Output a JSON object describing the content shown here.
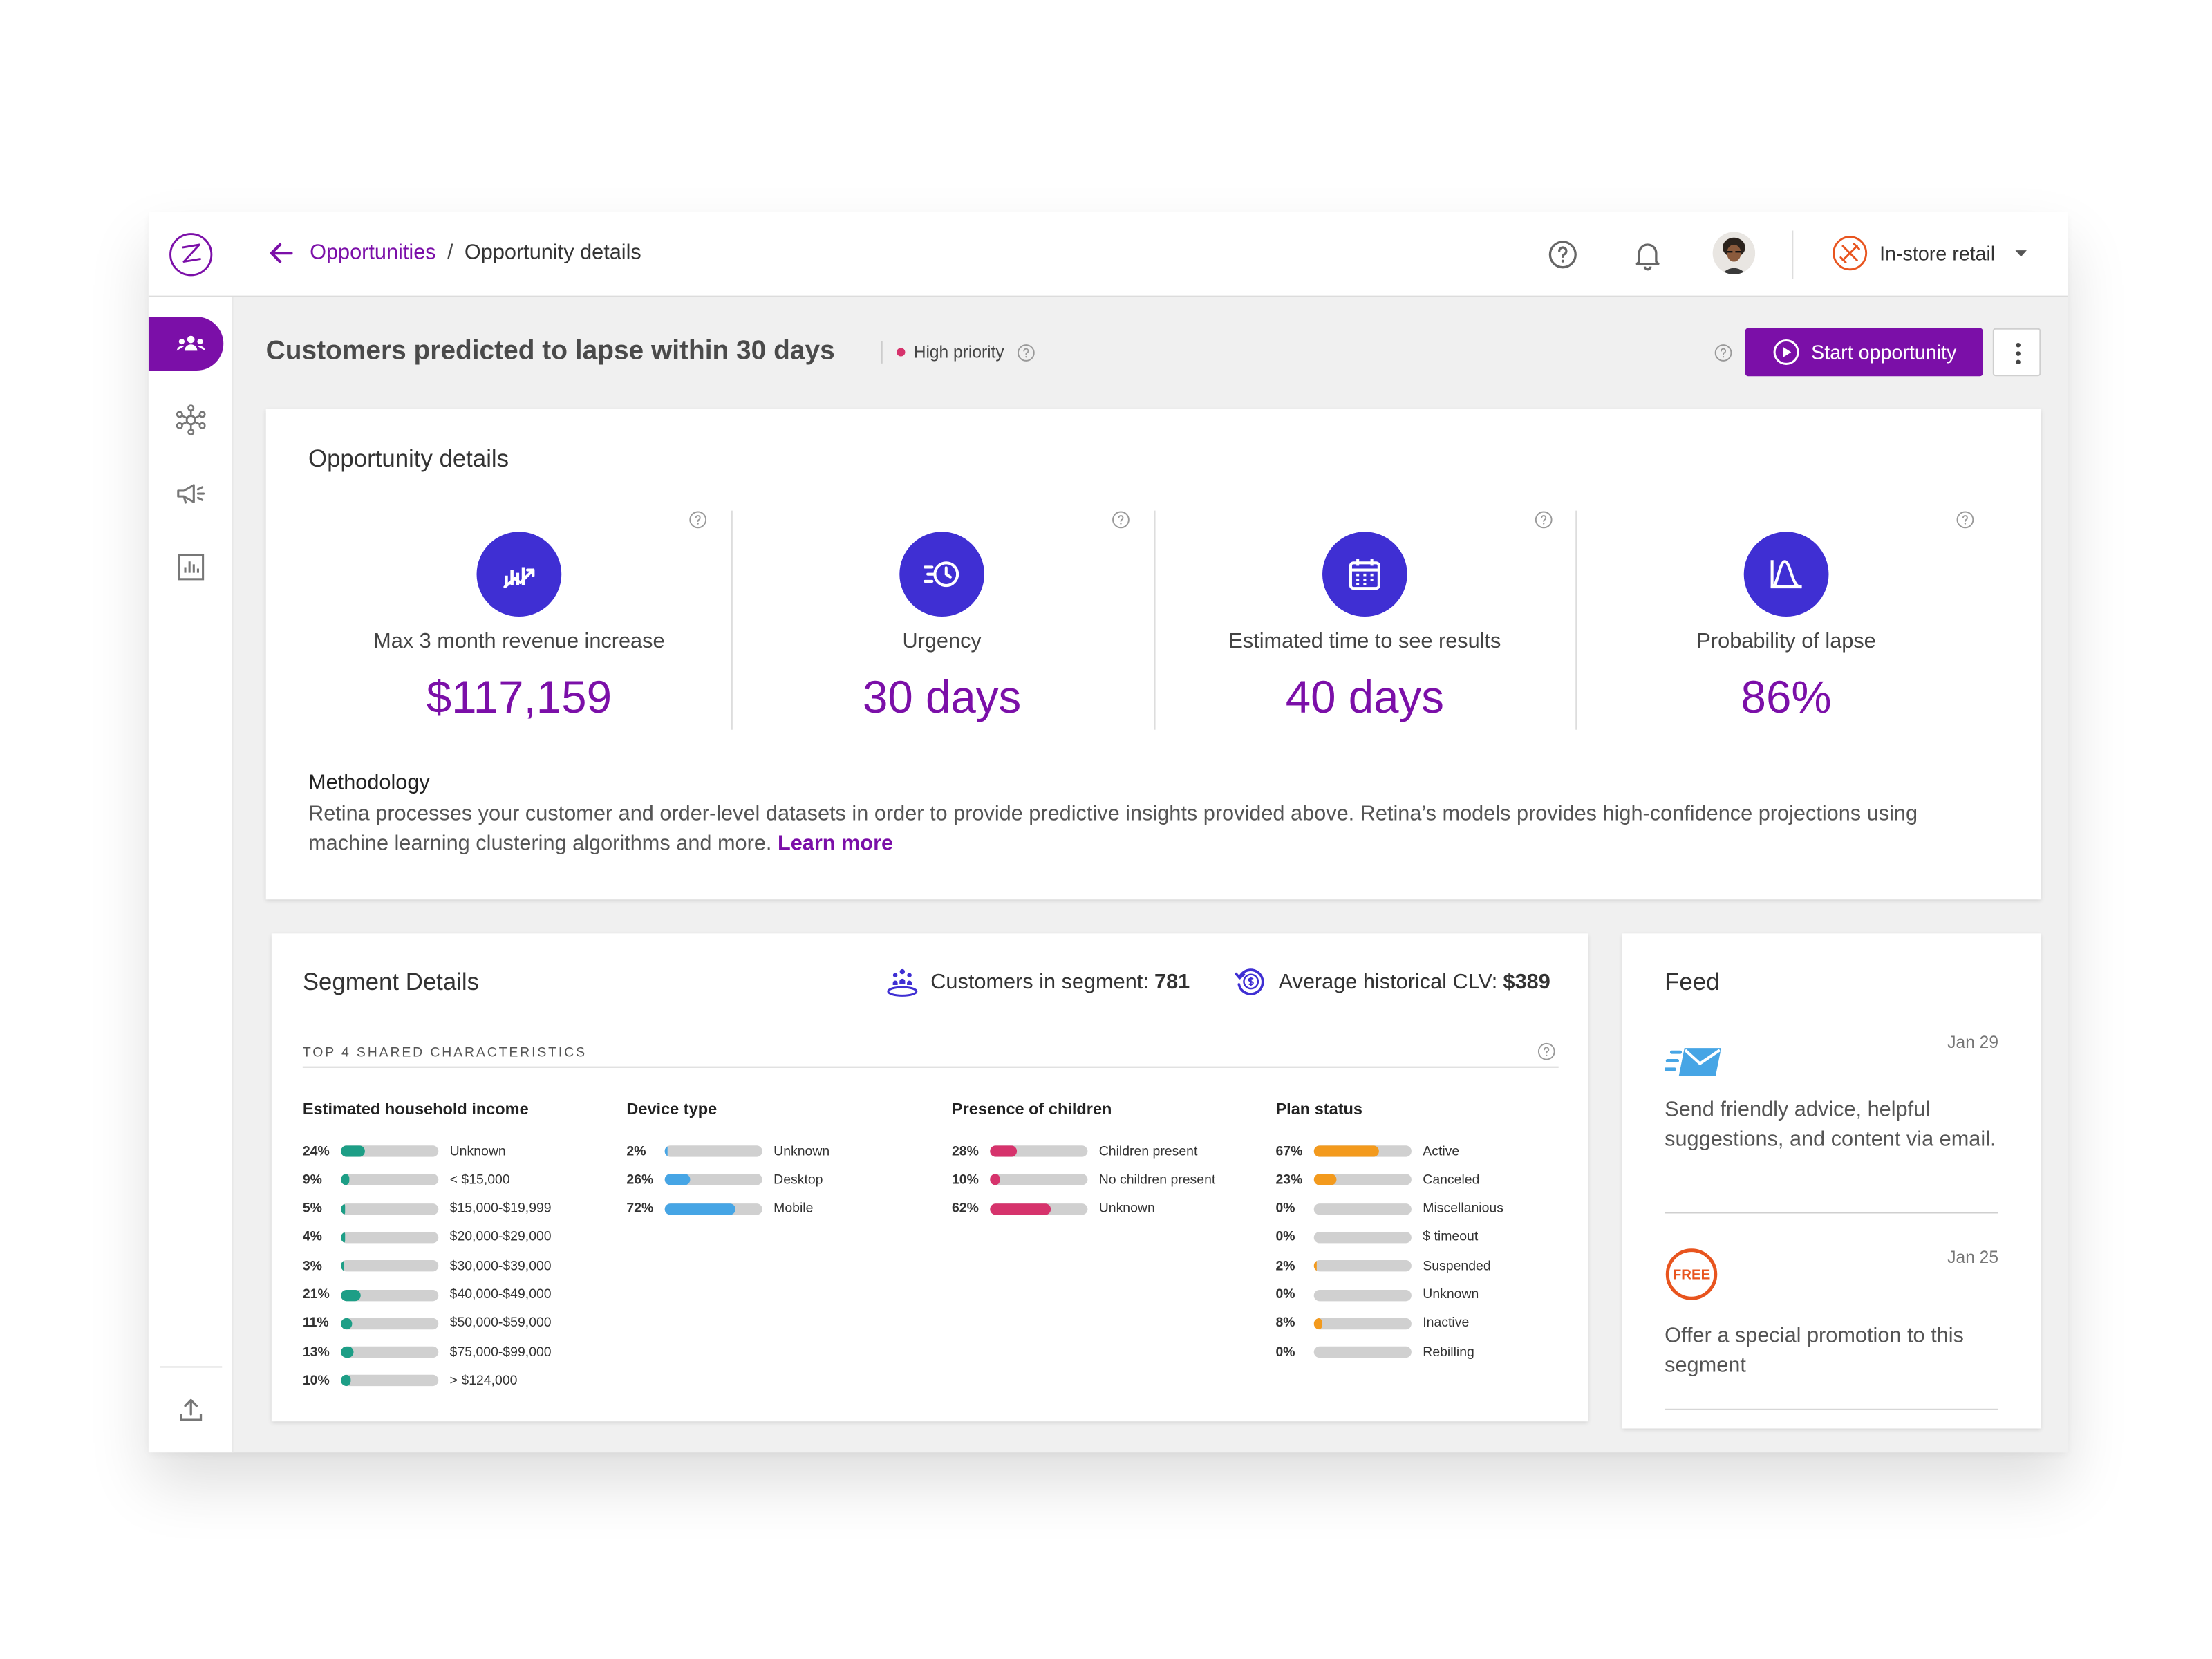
{
  "breadcrumb": {
    "parent": "Opportunities",
    "separator": "/",
    "current": "Opportunity details"
  },
  "header": {
    "store": "In-store retail"
  },
  "page": {
    "title": "Customers predicted to lapse within 30 days",
    "priority": "High priority",
    "start_button": "Start opportunity"
  },
  "details": {
    "title": "Opportunity details",
    "metrics": [
      {
        "label": "Max 3 month revenue increase",
        "value": "$117,159",
        "icon": "revenue-chart-icon"
      },
      {
        "label": "Urgency",
        "value": "30 days",
        "icon": "fast-clock-icon"
      },
      {
        "label": "Estimated time to see results",
        "value": "40 days",
        "icon": "calendar-icon"
      },
      {
        "label": "Probability of lapse",
        "value": "86%",
        "icon": "distribution-curve-icon"
      }
    ],
    "methodology_title": "Methodology",
    "methodology_text": "Retina processes your customer and order-level datasets in order to provide predictive insights provided above. Retina’s models provides high-confidence projections using machine learning clustering algorithms and more.",
    "learn_more": "Learn more"
  },
  "segment": {
    "title": "Segment Details",
    "customers_label": "Customers in segment:",
    "customers_value": "781",
    "clv_label": "Average historical CLV:",
    "clv_value": "$389",
    "characteristics_title": "TOP 4 SHARED CHARACTERISTICS",
    "columns": [
      {
        "title": "Estimated household income",
        "color": "#1d9e86",
        "rows": [
          {
            "pct": "24%",
            "value": 24,
            "label": "Unknown"
          },
          {
            "pct": "9%",
            "value": 9,
            "label": "< $15,000"
          },
          {
            "pct": "5%",
            "value": 5,
            "label": "$15,000-$19,999"
          },
          {
            "pct": "4%",
            "value": 4,
            "label": "$20,000-$29,000"
          },
          {
            "pct": "3%",
            "value": 3,
            "label": "$30,000-$39,000"
          },
          {
            "pct": "21%",
            "value": 21,
            "label": "$40,000-$49,000"
          },
          {
            "pct": "11%",
            "value": 11,
            "label": "$50,000-$59,000"
          },
          {
            "pct": "13%",
            "value": 13,
            "label": "$75,000-$99,000"
          },
          {
            "pct": "10%",
            "value": 10,
            "label": "> $124,000"
          }
        ]
      },
      {
        "title": "Device type",
        "color": "#46a5e5",
        "rows": [
          {
            "pct": "2%",
            "value": 2,
            "label": "Unknown"
          },
          {
            "pct": "26%",
            "value": 26,
            "label": "Desktop"
          },
          {
            "pct": "72%",
            "value": 72,
            "label": "Mobile"
          }
        ]
      },
      {
        "title": "Presence of children",
        "color": "#d6336c",
        "rows": [
          {
            "pct": "28%",
            "value": 28,
            "label": "Children present"
          },
          {
            "pct": "10%",
            "value": 10,
            "label": "No children present"
          },
          {
            "pct": "62%",
            "value": 62,
            "label": "Unknown"
          }
        ]
      },
      {
        "title": "Plan status",
        "color": "#f39a1d",
        "rows": [
          {
            "pct": "67%",
            "value": 67,
            "label": "Active"
          },
          {
            "pct": "23%",
            "value": 23,
            "label": "Canceled"
          },
          {
            "pct": "0%",
            "value": 0,
            "label": "Miscellanious"
          },
          {
            "pct": "0%",
            "value": 0,
            "label": "$ timeout"
          },
          {
            "pct": "2%",
            "value": 2,
            "label": "Suspended"
          },
          {
            "pct": "0%",
            "value": 0,
            "label": "Unknown"
          },
          {
            "pct": "8%",
            "value": 8,
            "label": "Inactive"
          },
          {
            "pct": "0%",
            "value": 0,
            "label": "Rebilling"
          }
        ]
      }
    ]
  },
  "feed": {
    "title": "Feed",
    "items": [
      {
        "date": "Jan 29",
        "text": "Send friendly advice, helpful suggestions, and content via email.",
        "icon": "email-send-icon"
      },
      {
        "date": "Jan 25",
        "text": "Offer a special promotion to this segment",
        "icon": "free-badge-icon",
        "badge": "FREE"
      }
    ]
  },
  "colors": {
    "accent": "#7b0fa8",
    "icon_circle": "#3f2fd3",
    "priority": "#d6336c",
    "email_icon": "#46a5e5",
    "free_badge": "#e8541e"
  }
}
